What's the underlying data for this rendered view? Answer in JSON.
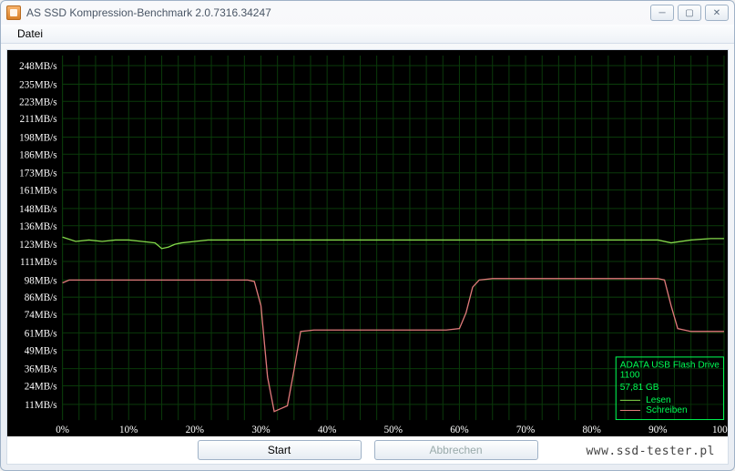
{
  "window": {
    "title": "AS SSD Kompression-Benchmark 2.0.7316.34247",
    "minimize_icon": "─",
    "maximize_icon": "▢",
    "close_icon": "✕"
  },
  "menubar": {
    "items": [
      "Datei"
    ]
  },
  "buttons": {
    "start": "Start",
    "abort": "Abbrechen"
  },
  "watermark": "www.ssd-tester.pl",
  "legend": {
    "device": "ADATA USB Flash Drive",
    "model": "1100",
    "capacity": "57,81 GB",
    "read_label": "Lesen",
    "write_label": "Schreiben",
    "read_color": "#84d94a",
    "write_color": "#e07a7a"
  },
  "chart_data": {
    "type": "line",
    "xlabel": "",
    "ylabel": "",
    "x_unit": "%",
    "y_unit": "MB/s",
    "xlim": [
      0,
      100
    ],
    "ylim": [
      0,
      255
    ],
    "x_ticks": [
      0,
      10,
      20,
      30,
      40,
      50,
      60,
      70,
      80,
      90,
      100
    ],
    "y_ticks": [
      11,
      24,
      36,
      49,
      61,
      74,
      86,
      98,
      111,
      123,
      136,
      148,
      161,
      173,
      186,
      198,
      211,
      223,
      235,
      248
    ],
    "x_tick_labels": [
      "0%",
      "10%",
      "20%",
      "30%",
      "40%",
      "50%",
      "60%",
      "70%",
      "80%",
      "90%",
      "100%"
    ],
    "y_tick_labels": [
      "11MB/s",
      "24MB/s",
      "36MB/s",
      "49MB/s",
      "61MB/s",
      "74MB/s",
      "86MB/s",
      "98MB/s",
      "111MB/s",
      "123MB/s",
      "136MB/s",
      "148MB/s",
      "161MB/s",
      "173MB/s",
      "186MB/s",
      "198MB/s",
      "211MB/s",
      "223MB/s",
      "235MB/s",
      "248MB/s"
    ],
    "series": [
      {
        "name": "Lesen",
        "color": "#84d94a",
        "x": [
          0,
          2,
          4,
          6,
          8,
          10,
          12,
          14,
          15,
          16,
          17,
          18,
          20,
          22,
          24,
          26,
          28,
          30,
          32,
          34,
          36,
          38,
          40,
          45,
          50,
          55,
          60,
          65,
          70,
          75,
          80,
          85,
          90,
          92,
          95,
          98,
          100
        ],
        "y": [
          128,
          125,
          126,
          125,
          126,
          126,
          125,
          124,
          120,
          121,
          123,
          124,
          125,
          126,
          126,
          126,
          126,
          126,
          126,
          126,
          126,
          126,
          126,
          126,
          126,
          126,
          126,
          126,
          126,
          126,
          126,
          126,
          126,
          124,
          126,
          127,
          127
        ]
      },
      {
        "name": "Schreiben",
        "color": "#e07a7a",
        "x": [
          0,
          1,
          5,
          10,
          15,
          20,
          25,
          28,
          29,
          30,
          31,
          32,
          33,
          34,
          35,
          36,
          38,
          40,
          45,
          50,
          55,
          58,
          60,
          61,
          62,
          63,
          65,
          70,
          75,
          80,
          85,
          88,
          90,
          91,
          92,
          93,
          94,
          95,
          98,
          100
        ],
        "y": [
          96,
          98,
          98,
          98,
          98,
          98,
          98,
          98,
          97,
          80,
          30,
          6,
          8,
          10,
          35,
          62,
          63,
          63,
          63,
          63,
          63,
          63,
          64,
          75,
          93,
          98,
          99,
          99,
          99,
          99,
          99,
          99,
          99,
          98,
          80,
          64,
          63,
          62,
          62,
          62
        ]
      }
    ]
  }
}
